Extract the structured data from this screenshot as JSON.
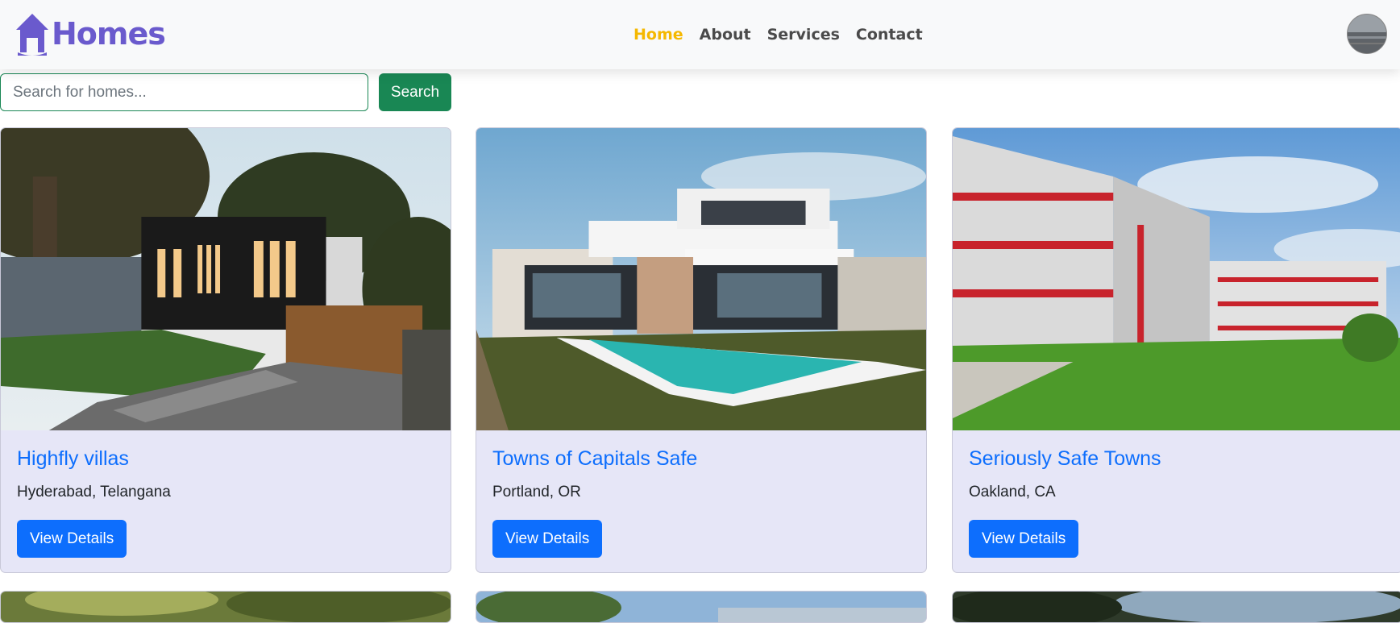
{
  "brand": {
    "name": "Homes",
    "icon": "house-icon",
    "color": "#6a5acd"
  },
  "nav": {
    "items": [
      {
        "label": "Home",
        "active": true
      },
      {
        "label": "About",
        "active": false
      },
      {
        "label": "Services",
        "active": false
      },
      {
        "label": "Contact",
        "active": false
      }
    ],
    "active_color": "#f5b800"
  },
  "search": {
    "placeholder": "Search for homes...",
    "value": "",
    "button_label": "Search",
    "accent": "#198754"
  },
  "listings": [
    {
      "title": "Highfly villas",
      "location": "Hyderabad, Telangana",
      "button_label": "View Details"
    },
    {
      "title": "Towns of Capitals Safe",
      "location": "Portland, OR",
      "button_label": "View Details"
    },
    {
      "title": "Seriously Safe Towns",
      "location": "Oakland, CA",
      "button_label": "View Details"
    }
  ],
  "colors": {
    "primary": "#0d6efd",
    "card_bg": "#e6e6f7"
  }
}
